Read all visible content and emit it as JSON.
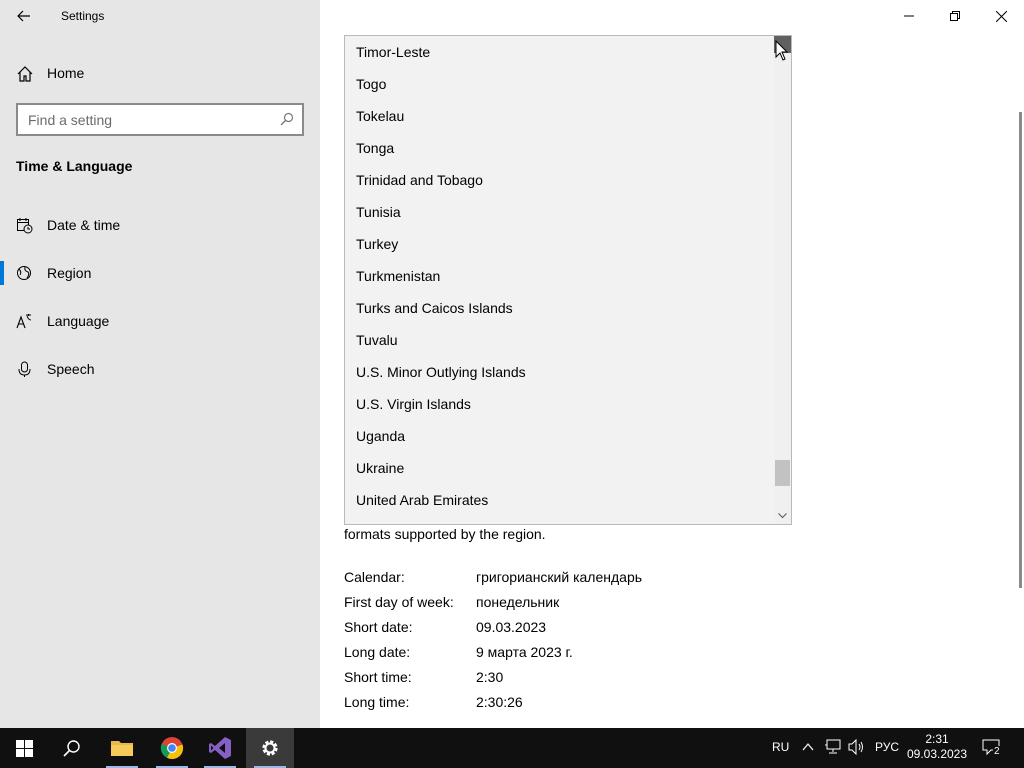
{
  "window": {
    "title": "Settings"
  },
  "sidebar": {
    "home_label": "Home",
    "search_placeholder": "Find a setting",
    "section_title": "Time & Language",
    "items": [
      {
        "label": "Date & time",
        "icon": "calendar-clock-icon"
      },
      {
        "label": "Region",
        "icon": "globe-icon",
        "active": true
      },
      {
        "label": "Language",
        "icon": "language-icon"
      },
      {
        "label": "Speech",
        "icon": "microphone-icon"
      }
    ]
  },
  "country_dropdown": {
    "items": [
      "Timor-Leste",
      "Togo",
      "Tokelau",
      "Tonga",
      "Trinidad and Tobago",
      "Tunisia",
      "Turkey",
      "Turkmenistan",
      "Turks and Caicos Islands",
      "Tuvalu",
      "U.S. Minor Outlying Islands",
      "U.S. Virgin Islands",
      "Uganda",
      "Ukraine",
      "United Arab Emirates"
    ]
  },
  "region_format": {
    "description_tail": "formats supported by the region.",
    "rows": [
      {
        "key": "Calendar:",
        "value": "григорианский календарь"
      },
      {
        "key": "First day of week:",
        "value": "понедельник"
      },
      {
        "key": "Short date:",
        "value": "09.03.2023"
      },
      {
        "key": "Long date:",
        "value": "9 марта 2023 г."
      },
      {
        "key": "Short time:",
        "value": "2:30"
      },
      {
        "key": "Long time:",
        "value": "2:30:26"
      }
    ]
  },
  "taskbar": {
    "apps": [
      "start-icon",
      "search-icon",
      "file-explorer-icon",
      "chrome-icon",
      "visual-studio-icon",
      "settings-gear-icon"
    ],
    "input_lang": "RU",
    "keyboard_lang": "РУС",
    "time": "2:31",
    "date": "09.03.2023",
    "notification_count": "2"
  },
  "colors": {
    "accent": "#0078d7",
    "sidebar_bg": "#e6e6e6",
    "taskbar_bg": "#101010"
  }
}
